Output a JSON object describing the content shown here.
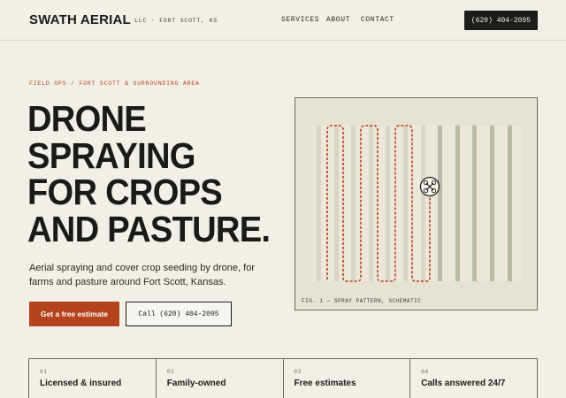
{
  "header": {
    "brand": "SWATH AERIAL",
    "brand_sub": "LLC · FORT SCOTT, KS",
    "nav": [
      {
        "label": "SERVICES"
      },
      {
        "label": "ABOUT"
      },
      {
        "label": "CONTACT"
      }
    ],
    "cta_phone": "(620) 404-2095"
  },
  "hero": {
    "eyebrow": "FIELD OPS / FORT SCOTT & SURROUNDING AREA",
    "headline_lines": [
      "DRONE",
      "SPRAYING",
      "FOR CROPS",
      "AND PASTURE."
    ],
    "lede": "Aerial spraying and cover crop seeding by drone, for farms and pasture around Fort Scott, Kansas.",
    "primary_button": "Get a free estimate",
    "secondary_button": "Call (620) 404-2095"
  },
  "figure": {
    "caption": "FIG. 1 — SPRAY PATTERN, SCHEMATIC",
    "icon": "drone-icon",
    "colors": {
      "path": "#b5411b",
      "sprayed": "#e9e5d8",
      "unsprayed": "#b8bca6"
    }
  },
  "features": [
    {
      "num": "01",
      "label": "Licensed & insured"
    },
    {
      "num": "02",
      "label": "Family-owned"
    },
    {
      "num": "03",
      "label": "Free estimates"
    },
    {
      "num": "04",
      "label": "Calls answered 24/7"
    }
  ]
}
